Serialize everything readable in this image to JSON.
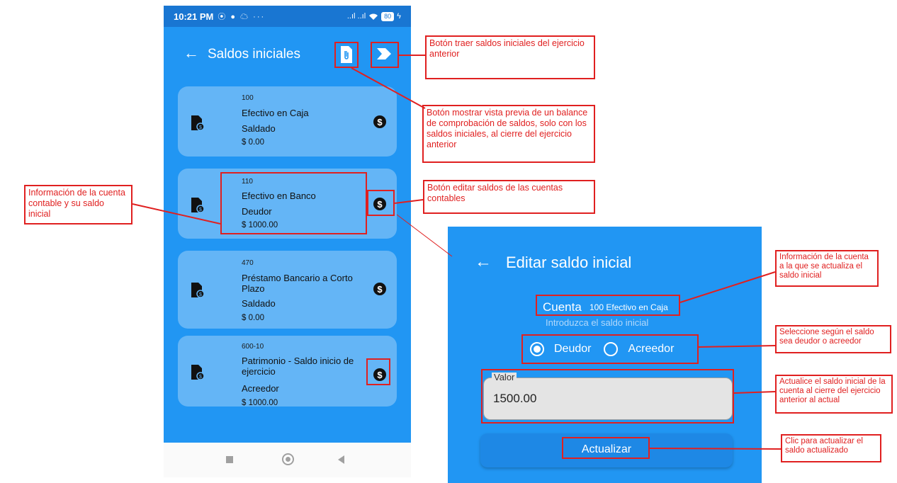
{
  "status_bar": {
    "time": "10:21 PM",
    "left_icons": "⦿ ● ☁ ···",
    "right_icons": "..ıl ..ıl",
    "battery": "80"
  },
  "main_screen": {
    "title": "Saldos iniciales",
    "cards": [
      {
        "code": "100",
        "name": "Efectivo en Caja",
        "state": "Saldado",
        "amount": "$ 0.00"
      },
      {
        "code": "110",
        "name": "Efectivo en Banco",
        "state": "Deudor",
        "amount": "$ 1000.00"
      },
      {
        "code": "470",
        "name": "Préstamo Bancario a Corto Plazo",
        "state": "Saldado",
        "amount": "$ 0.00"
      },
      {
        "code": "600-10",
        "name": "Patrimonio - Saldo inicio de ejercicio",
        "state": "Acreedor",
        "amount": "$ 1000.00"
      }
    ]
  },
  "edit_screen": {
    "title": "Editar saldo inicial",
    "account_label": "Cuenta",
    "account_value": "100 Efectivo en Caja",
    "hint": "Introduzca el saldo inicial",
    "radio_debit": "Deudor",
    "radio_credit": "Acreedor",
    "selected": "Deudor",
    "field_label": "Valor",
    "field_value": "1500.00",
    "button": "Actualizar"
  },
  "annotations": {
    "bring_initial": "Botón traer saldos iniciales del ejercicio anterior",
    "preview": "Botón mostrar vista previa de un balance de comprobación de saldos, solo con los saldos iniciales, al cierre del ejercicio anterior",
    "edit_balances": "Botón editar saldos de las cuentas contables",
    "account_info": "Información de la cuenta contable y su saldo inicial",
    "account_updated": "Información de la cuenta a la que se actualiza el saldo inicial",
    "select_type": "Seleccione según el saldo sea deudor o acreedor",
    "update_value": "Actualice el saldo inicial de la cuenta al cierre del ejercicio anterior al actual",
    "click_update": "Clic para actualizar el saldo actualizado"
  },
  "colors": {
    "primary": "#2196f3",
    "card": "#64b5f6",
    "annotation": "#e02020"
  }
}
